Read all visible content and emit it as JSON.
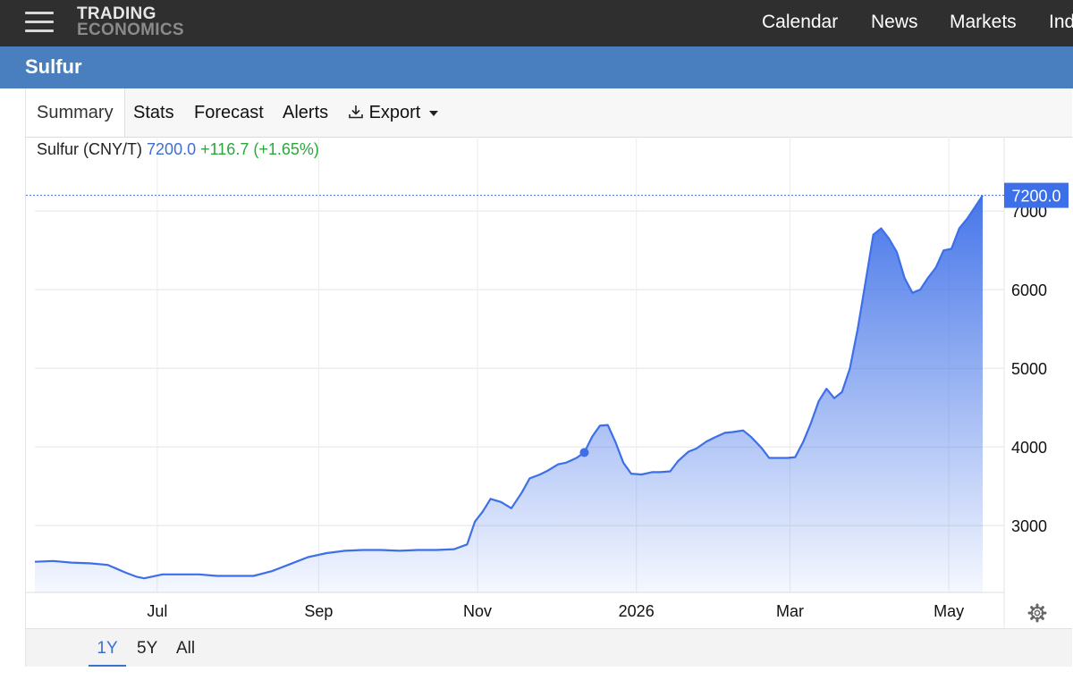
{
  "header": {
    "menu_icon": "hamburger-menu-icon",
    "logo_line1": "TRADING",
    "logo_line2": "ECONOMICS",
    "nav": [
      "Calendar",
      "News",
      "Markets",
      "Ind"
    ]
  },
  "page": {
    "title": "Sulfur"
  },
  "tabs": {
    "summary": "Summary",
    "stats": "Stats",
    "forecast": "Forecast",
    "alerts": "Alerts",
    "export": "Export",
    "export_icon": "download-icon"
  },
  "quote": {
    "name": "Sulfur (CNY/T)",
    "price": "7200.0",
    "change": "+116.7 (+1.65%)",
    "price_color": "#3d6fd0",
    "change_color": "#2aa83a"
  },
  "ranges": {
    "one_year": "1Y",
    "five_year": "5Y",
    "all": "All",
    "selected": "1Y"
  },
  "settings_icon": "gear-icon",
  "colors": {
    "line": "#3d6fe8",
    "fill_top": "#3d6fe8",
    "last_label_bg": "#3d6fe8"
  },
  "chart_data": {
    "type": "area",
    "series": [
      {
        "values": [
          [
            "2025-05-15",
            2540
          ],
          [
            "2025-05-22",
            2550
          ],
          [
            "2025-05-29",
            2530
          ],
          [
            "2025-06-05",
            2520
          ],
          [
            "2025-06-12",
            2500
          ],
          [
            "2025-06-19",
            2400
          ],
          [
            "2025-06-23",
            2350
          ],
          [
            "2025-06-26",
            2330
          ],
          [
            "2025-07-03",
            2380
          ],
          [
            "2025-07-10",
            2380
          ],
          [
            "2025-07-17",
            2380
          ],
          [
            "2025-07-24",
            2360
          ],
          [
            "2025-07-31",
            2360
          ],
          [
            "2025-08-07",
            2360
          ],
          [
            "2025-08-14",
            2420
          ],
          [
            "2025-08-21",
            2510
          ],
          [
            "2025-08-28",
            2600
          ],
          [
            "2025-09-04",
            2650
          ],
          [
            "2025-09-11",
            2680
          ],
          [
            "2025-09-18",
            2690
          ],
          [
            "2025-09-25",
            2690
          ],
          [
            "2025-10-02",
            2680
          ],
          [
            "2025-10-09",
            2690
          ],
          [
            "2025-10-16",
            2690
          ],
          [
            "2025-10-23",
            2700
          ],
          [
            "2025-10-28",
            2760
          ],
          [
            "2025-10-31",
            3050
          ],
          [
            "2025-11-03",
            3180
          ],
          [
            "2025-11-06",
            3340
          ],
          [
            "2025-11-10",
            3300
          ],
          [
            "2025-11-14",
            3220
          ],
          [
            "2025-11-18",
            3420
          ],
          [
            "2025-11-21",
            3600
          ],
          [
            "2025-11-25",
            3650
          ],
          [
            "2025-11-28",
            3700
          ],
          [
            "2025-12-02",
            3780
          ],
          [
            "2025-12-05",
            3800
          ],
          [
            "2025-12-09",
            3860
          ],
          [
            "2025-12-12",
            3930
          ],
          [
            "2025-12-15",
            4130
          ],
          [
            "2025-12-18",
            4270
          ],
          [
            "2025-12-21",
            4280
          ],
          [
            "2025-12-24",
            4060
          ],
          [
            "2025-12-27",
            3800
          ],
          [
            "2025-12-30",
            3660
          ],
          [
            "2026-01-03",
            3650
          ],
          [
            "2026-01-07",
            3680
          ],
          [
            "2026-01-10",
            3680
          ],
          [
            "2026-01-14",
            3690
          ],
          [
            "2026-01-17",
            3820
          ],
          [
            "2026-01-21",
            3940
          ],
          [
            "2026-01-24",
            3980
          ],
          [
            "2026-01-28",
            4070
          ],
          [
            "2026-01-31",
            4120
          ],
          [
            "2026-02-04",
            4180
          ],
          [
            "2026-02-07",
            4190
          ],
          [
            "2026-02-11",
            4210
          ],
          [
            "2026-02-14",
            4130
          ],
          [
            "2026-02-18",
            3990
          ],
          [
            "2026-02-21",
            3860
          ],
          [
            "2026-02-25",
            3860
          ],
          [
            "2026-02-28",
            3860
          ],
          [
            "2026-03-03",
            3870
          ],
          [
            "2026-03-06",
            4060
          ],
          [
            "2026-03-09",
            4300
          ],
          [
            "2026-03-12",
            4580
          ],
          [
            "2026-03-15",
            4740
          ],
          [
            "2026-03-18",
            4620
          ],
          [
            "2026-03-21",
            4700
          ],
          [
            "2026-03-24",
            5000
          ],
          [
            "2026-03-27",
            5500
          ],
          [
            "2026-03-30",
            6100
          ],
          [
            "2026-04-02",
            6700
          ],
          [
            "2026-04-05",
            6780
          ],
          [
            "2026-04-08",
            6650
          ],
          [
            "2026-04-11",
            6480
          ],
          [
            "2026-04-14",
            6150
          ],
          [
            "2026-04-17",
            5960
          ],
          [
            "2026-04-20",
            6000
          ],
          [
            "2026-04-23",
            6150
          ],
          [
            "2026-04-26",
            6280
          ],
          [
            "2026-04-29",
            6500
          ],
          [
            "2026-05-02",
            6520
          ],
          [
            "2026-05-05",
            6780
          ],
          [
            "2026-05-08",
            6900
          ],
          [
            "2026-05-11",
            7050
          ],
          [
            "2026-05-14",
            7200
          ]
        ]
      }
    ],
    "highlight_point": [
      "2025-12-12",
      3930
    ],
    "x_ticks": [
      {
        "date": "2025-07-01",
        "label": "Jul"
      },
      {
        "date": "2025-09-01",
        "label": "Sep"
      },
      {
        "date": "2025-11-01",
        "label": "Nov"
      },
      {
        "date": "2026-01-01",
        "label": "2026"
      },
      {
        "date": "2026-03-01",
        "label": "Mar"
      },
      {
        "date": "2026-05-01",
        "label": "May"
      }
    ],
    "x_range": [
      "2025-05-15",
      "2026-05-14"
    ],
    "y_ticks": [
      3000,
      4000,
      5000,
      6000,
      7000
    ],
    "ylim": [
      2150,
      7400
    ],
    "last_value_label": "7200.0",
    "grid": true,
    "y_axis_side": "right"
  }
}
